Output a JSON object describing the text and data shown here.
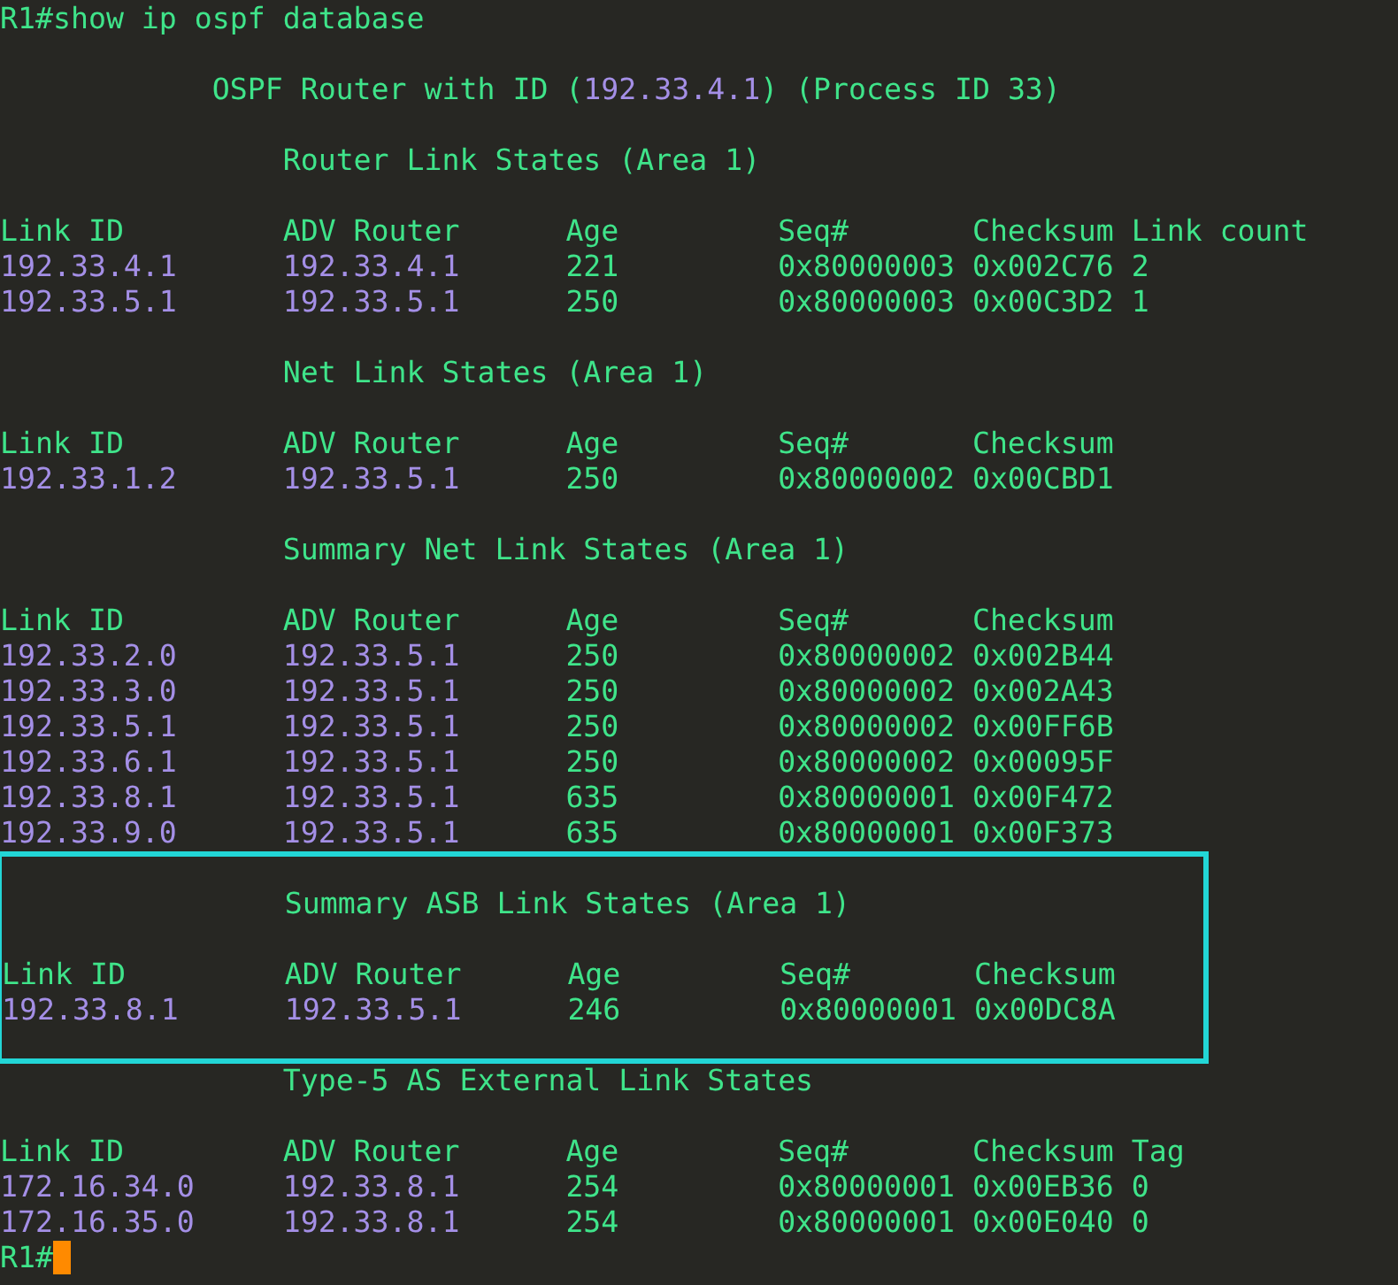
{
  "terminal": {
    "command_line": {
      "prompt": "R1#",
      "command": "show ip ospf database"
    },
    "header": {
      "prefix": "OSPF Router with ID (",
      "router_id": "192.33.4.1",
      "suffix": ") (Process ID 33)"
    },
    "sections": [
      {
        "title": "Router Link States (Area 1)",
        "highlighted": false,
        "columns": [
          {
            "label": "Link ID",
            "kind": "address"
          },
          {
            "label": "ADV Router",
            "kind": "address"
          },
          {
            "label": "Age",
            "kind": "value"
          },
          {
            "label": "Seq#",
            "kind": "value"
          },
          {
            "label": "Checksum",
            "kind": "value"
          },
          {
            "label": "Link count",
            "kind": "value"
          }
        ],
        "rows": [
          [
            "192.33.4.1",
            "192.33.4.1",
            "221",
            "0x80000003",
            "0x002C76",
            "2"
          ],
          [
            "192.33.5.1",
            "192.33.5.1",
            "250",
            "0x80000003",
            "0x00C3D2",
            "1"
          ]
        ]
      },
      {
        "title": "Net Link States (Area 1)",
        "highlighted": false,
        "columns": [
          {
            "label": "Link ID",
            "kind": "address"
          },
          {
            "label": "ADV Router",
            "kind": "address"
          },
          {
            "label": "Age",
            "kind": "value"
          },
          {
            "label": "Seq#",
            "kind": "value"
          },
          {
            "label": "Checksum",
            "kind": "value"
          }
        ],
        "rows": [
          [
            "192.33.1.2",
            "192.33.5.1",
            "250",
            "0x80000002",
            "0x00CBD1"
          ]
        ]
      },
      {
        "title": "Summary Net Link States (Area 1)",
        "highlighted": false,
        "columns": [
          {
            "label": "Link ID",
            "kind": "address"
          },
          {
            "label": "ADV Router",
            "kind": "address"
          },
          {
            "label": "Age",
            "kind": "value"
          },
          {
            "label": "Seq#",
            "kind": "value"
          },
          {
            "label": "Checksum",
            "kind": "value"
          }
        ],
        "rows": [
          [
            "192.33.2.0",
            "192.33.5.1",
            "250",
            "0x80000002",
            "0x002B44"
          ],
          [
            "192.33.3.0",
            "192.33.5.1",
            "250",
            "0x80000002",
            "0x002A43"
          ],
          [
            "192.33.5.1",
            "192.33.5.1",
            "250",
            "0x80000002",
            "0x00FF6B"
          ],
          [
            "192.33.6.1",
            "192.33.5.1",
            "250",
            "0x80000002",
            "0x00095F"
          ],
          [
            "192.33.8.1",
            "192.33.5.1",
            "635",
            "0x80000001",
            "0x00F472"
          ],
          [
            "192.33.9.0",
            "192.33.5.1",
            "635",
            "0x80000001",
            "0x00F373"
          ]
        ]
      },
      {
        "title": "Summary ASB Link States (Area 1)",
        "highlighted": true,
        "columns": [
          {
            "label": "Link ID",
            "kind": "address"
          },
          {
            "label": "ADV Router",
            "kind": "address"
          },
          {
            "label": "Age",
            "kind": "value"
          },
          {
            "label": "Seq#",
            "kind": "value"
          },
          {
            "label": "Checksum",
            "kind": "value"
          }
        ],
        "rows": [
          [
            "192.33.8.1",
            "192.33.5.1",
            "246",
            "0x80000001",
            "0x00DC8A"
          ]
        ]
      },
      {
        "title": "Type-5 AS External Link States",
        "highlighted": false,
        "columns": [
          {
            "label": "Link ID",
            "kind": "address"
          },
          {
            "label": "ADV Router",
            "kind": "address"
          },
          {
            "label": "Age",
            "kind": "value"
          },
          {
            "label": "Seq#",
            "kind": "value"
          },
          {
            "label": "Checksum",
            "kind": "value"
          },
          {
            "label": "Tag",
            "kind": "value"
          }
        ],
        "rows": [
          [
            "172.16.34.0",
            "192.33.8.1",
            "254",
            "0x80000001",
            "0x00EB36",
            "0"
          ],
          [
            "172.16.35.0",
            "192.33.8.1",
            "254",
            "0x80000001",
            "0x00E040",
            "0"
          ]
        ]
      }
    ],
    "final_prompt": {
      "prompt": "R1#",
      "cursor": true
    }
  }
}
